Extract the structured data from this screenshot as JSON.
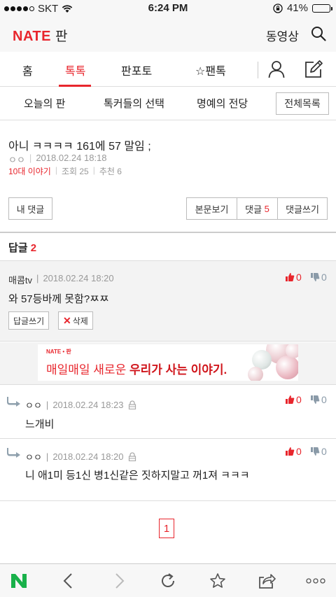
{
  "status_bar": {
    "carrier": "SKT",
    "time": "6:24 PM",
    "battery": "41%",
    "battery_level": 0.41
  },
  "app_header": {
    "logo": "NATE",
    "section": "판",
    "video_link": "동영상",
    "search_icon": "search-icon"
  },
  "main_tabs": {
    "home": "홈",
    "toktok": "톡톡",
    "panpoto": "판포토",
    "fantok": "☆팬톡",
    "active": "톡톡"
  },
  "sub_nav": {
    "today": "오늘의 판",
    "talkers_choice": "톡커들의 선택",
    "hall_of_fame": "명예의 전당",
    "all_list": "전체목록"
  },
  "post": {
    "title": "아니 ㅋㅋㅋㅋ 161에 57 말임 ;",
    "author": "ㅇㅇ",
    "date": "2018.02.24 18:18",
    "category": "10대 이야기",
    "views": "조회 25",
    "recommends": "추천 6"
  },
  "actions": {
    "my_comments": "내 댓글",
    "view_post": "본문보기",
    "comments_label": "댓글",
    "comments_count": "5",
    "write_comment": "댓글쓰기"
  },
  "replies_heading": {
    "label": "답글",
    "count": "2"
  },
  "comment": {
    "author": "매콤tv",
    "date": "2018.02.24 18:20",
    "text": "와 57등바께 못함?ㅉㅉ",
    "up": "0",
    "down": "0",
    "reply_button": "답글쓰기",
    "delete_button": "삭제"
  },
  "ad": {
    "logo": "NATE • 판",
    "text_plain": "매일매일 새로운 ",
    "text_bold": "우리가 사는 이야기."
  },
  "replies": [
    {
      "author": "ㅇㅇ",
      "date": "2018.02.24 18:23",
      "text": "느개비",
      "up": "0",
      "down": "0"
    },
    {
      "author": "ㅇㅇ",
      "date": "2018.02.24 18:20",
      "text": "니 애1미 등1신 병1신같은 짓하지말고 꺼1져 ㅋㅋㅋ",
      "up": "0",
      "down": "0"
    }
  ],
  "pagination": {
    "current": "1"
  },
  "colors": {
    "accent": "#e8262d",
    "gray_bg": "#f3f3f3",
    "nate_green": "#19b14a"
  }
}
